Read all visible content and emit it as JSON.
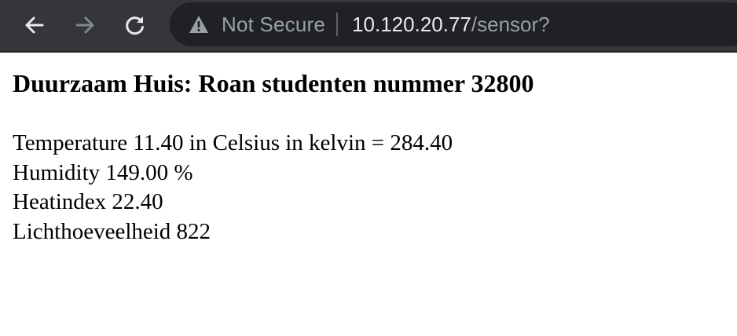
{
  "browser": {
    "security_label": "Not Secure",
    "url_host": "10.120.20.77",
    "url_path": "/sensor?",
    "icons": {
      "back": "arrow-left-icon",
      "forward": "arrow-right-icon",
      "reload": "reload-icon",
      "warning": "warning-triangle-icon"
    },
    "colors": {
      "toolbar": "#35363a",
      "omnibox": "#202124"
    }
  },
  "page": {
    "heading": "Duurzaam Huis: Roan studenten nummer 32800",
    "readings": [
      "Temperature 11.40 in Celsius in kelvin = 284.40",
      "Humidity 149.00 %",
      "Heatindex 22.40",
      "Lichthoeveelheid 822"
    ]
  }
}
